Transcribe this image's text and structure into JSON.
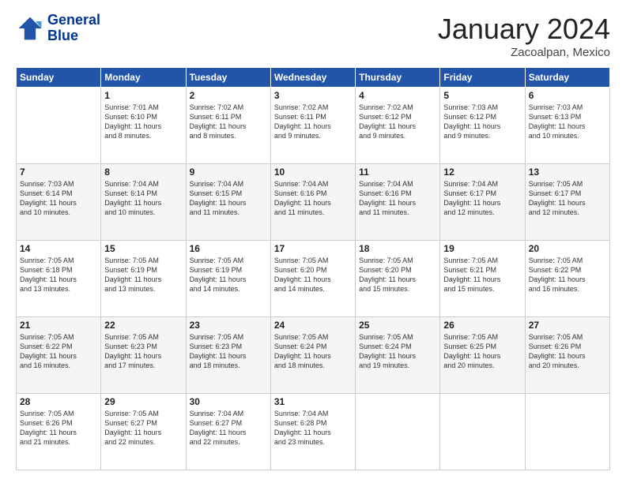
{
  "logo": {
    "line1": "General",
    "line2": "Blue"
  },
  "title": {
    "month": "January 2024",
    "location": "Zacoalpan, Mexico"
  },
  "days_header": [
    "Sunday",
    "Monday",
    "Tuesday",
    "Wednesday",
    "Thursday",
    "Friday",
    "Saturday"
  ],
  "weeks": [
    [
      {
        "num": "",
        "info": ""
      },
      {
        "num": "1",
        "info": "Sunrise: 7:01 AM\nSunset: 6:10 PM\nDaylight: 11 hours\nand 8 minutes."
      },
      {
        "num": "2",
        "info": "Sunrise: 7:02 AM\nSunset: 6:11 PM\nDaylight: 11 hours\nand 8 minutes."
      },
      {
        "num": "3",
        "info": "Sunrise: 7:02 AM\nSunset: 6:11 PM\nDaylight: 11 hours\nand 9 minutes."
      },
      {
        "num": "4",
        "info": "Sunrise: 7:02 AM\nSunset: 6:12 PM\nDaylight: 11 hours\nand 9 minutes."
      },
      {
        "num": "5",
        "info": "Sunrise: 7:03 AM\nSunset: 6:12 PM\nDaylight: 11 hours\nand 9 minutes."
      },
      {
        "num": "6",
        "info": "Sunrise: 7:03 AM\nSunset: 6:13 PM\nDaylight: 11 hours\nand 10 minutes."
      }
    ],
    [
      {
        "num": "7",
        "info": "Sunrise: 7:03 AM\nSunset: 6:14 PM\nDaylight: 11 hours\nand 10 minutes."
      },
      {
        "num": "8",
        "info": "Sunrise: 7:04 AM\nSunset: 6:14 PM\nDaylight: 11 hours\nand 10 minutes."
      },
      {
        "num": "9",
        "info": "Sunrise: 7:04 AM\nSunset: 6:15 PM\nDaylight: 11 hours\nand 11 minutes."
      },
      {
        "num": "10",
        "info": "Sunrise: 7:04 AM\nSunset: 6:16 PM\nDaylight: 11 hours\nand 11 minutes."
      },
      {
        "num": "11",
        "info": "Sunrise: 7:04 AM\nSunset: 6:16 PM\nDaylight: 11 hours\nand 11 minutes."
      },
      {
        "num": "12",
        "info": "Sunrise: 7:04 AM\nSunset: 6:17 PM\nDaylight: 11 hours\nand 12 minutes."
      },
      {
        "num": "13",
        "info": "Sunrise: 7:05 AM\nSunset: 6:17 PM\nDaylight: 11 hours\nand 12 minutes."
      }
    ],
    [
      {
        "num": "14",
        "info": "Sunrise: 7:05 AM\nSunset: 6:18 PM\nDaylight: 11 hours\nand 13 minutes."
      },
      {
        "num": "15",
        "info": "Sunrise: 7:05 AM\nSunset: 6:19 PM\nDaylight: 11 hours\nand 13 minutes."
      },
      {
        "num": "16",
        "info": "Sunrise: 7:05 AM\nSunset: 6:19 PM\nDaylight: 11 hours\nand 14 minutes."
      },
      {
        "num": "17",
        "info": "Sunrise: 7:05 AM\nSunset: 6:20 PM\nDaylight: 11 hours\nand 14 minutes."
      },
      {
        "num": "18",
        "info": "Sunrise: 7:05 AM\nSunset: 6:20 PM\nDaylight: 11 hours\nand 15 minutes."
      },
      {
        "num": "19",
        "info": "Sunrise: 7:05 AM\nSunset: 6:21 PM\nDaylight: 11 hours\nand 15 minutes."
      },
      {
        "num": "20",
        "info": "Sunrise: 7:05 AM\nSunset: 6:22 PM\nDaylight: 11 hours\nand 16 minutes."
      }
    ],
    [
      {
        "num": "21",
        "info": "Sunrise: 7:05 AM\nSunset: 6:22 PM\nDaylight: 11 hours\nand 16 minutes."
      },
      {
        "num": "22",
        "info": "Sunrise: 7:05 AM\nSunset: 6:23 PM\nDaylight: 11 hours\nand 17 minutes."
      },
      {
        "num": "23",
        "info": "Sunrise: 7:05 AM\nSunset: 6:23 PM\nDaylight: 11 hours\nand 18 minutes."
      },
      {
        "num": "24",
        "info": "Sunrise: 7:05 AM\nSunset: 6:24 PM\nDaylight: 11 hours\nand 18 minutes."
      },
      {
        "num": "25",
        "info": "Sunrise: 7:05 AM\nSunset: 6:24 PM\nDaylight: 11 hours\nand 19 minutes."
      },
      {
        "num": "26",
        "info": "Sunrise: 7:05 AM\nSunset: 6:25 PM\nDaylight: 11 hours\nand 20 minutes."
      },
      {
        "num": "27",
        "info": "Sunrise: 7:05 AM\nSunset: 6:26 PM\nDaylight: 11 hours\nand 20 minutes."
      }
    ],
    [
      {
        "num": "28",
        "info": "Sunrise: 7:05 AM\nSunset: 6:26 PM\nDaylight: 11 hours\nand 21 minutes."
      },
      {
        "num": "29",
        "info": "Sunrise: 7:05 AM\nSunset: 6:27 PM\nDaylight: 11 hours\nand 22 minutes."
      },
      {
        "num": "30",
        "info": "Sunrise: 7:04 AM\nSunset: 6:27 PM\nDaylight: 11 hours\nand 22 minutes."
      },
      {
        "num": "31",
        "info": "Sunrise: 7:04 AM\nSunset: 6:28 PM\nDaylight: 11 hours\nand 23 minutes."
      },
      {
        "num": "",
        "info": ""
      },
      {
        "num": "",
        "info": ""
      },
      {
        "num": "",
        "info": ""
      }
    ]
  ]
}
